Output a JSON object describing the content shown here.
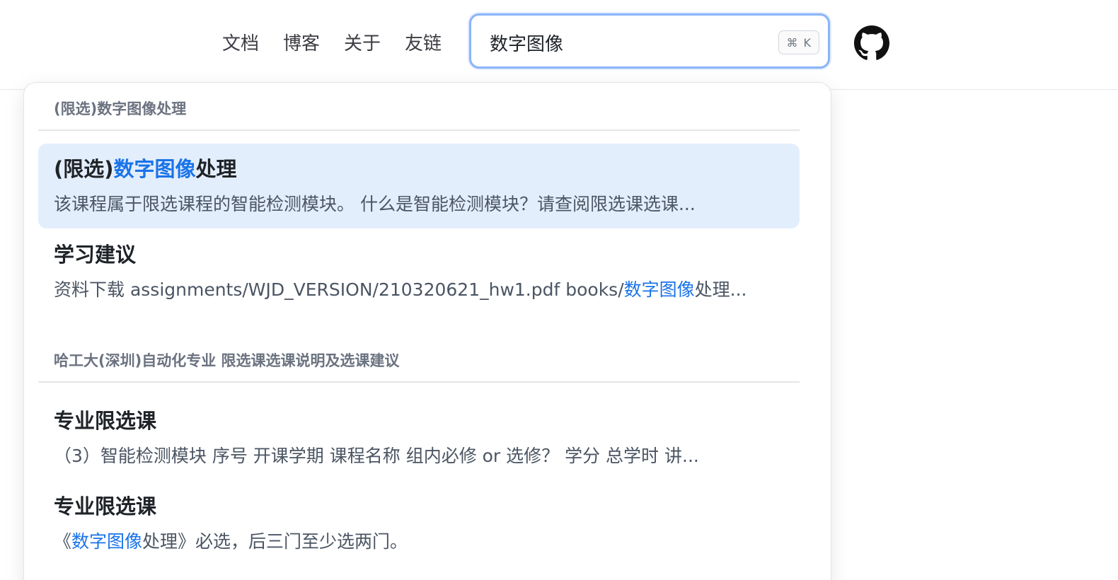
{
  "navbar": {
    "links": [
      "文档",
      "博客",
      "关于",
      "友链"
    ],
    "search": {
      "value": "数字图像",
      "shortcut_symbol": "⌘",
      "shortcut_key": "K"
    },
    "github_icon": "github-icon"
  },
  "dropdown": {
    "groups": [
      {
        "title": "(限选)数字图像处理",
        "results": [
          {
            "title_pre": "(限选)",
            "title_hl": "数字图像",
            "title_post": "处理",
            "snippet": "该课程属于限选课程的智能检测模块。 什么是智能检测模块？请查阅限选课选课...",
            "active": true
          },
          {
            "title": "学习建议",
            "snippet_pre": "资料下载 assignments/WJD_VERSION/210320621_hw1.pdf books/",
            "snippet_hl": "数字图像",
            "snippet_post": "处理..."
          }
        ]
      },
      {
        "title": "哈工大(深圳)自动化专业 限选课选课说明及选课建议",
        "results": [
          {
            "title": "专业限选课",
            "snippet": "（3）智能检测模块 序号 开课学期 课程名称 组内必修 or 选修？ 学分 总学时 讲..."
          },
          {
            "title": "专业限选课",
            "snippet_pre": "《",
            "snippet_hl": "数字图像",
            "snippet_post": "处理》必选，后三门至少选两门。"
          }
        ]
      }
    ]
  },
  "colors": {
    "highlight": "#1a73e8",
    "active_bg": "#e3eefc",
    "search_border": "#8ab4f8"
  }
}
